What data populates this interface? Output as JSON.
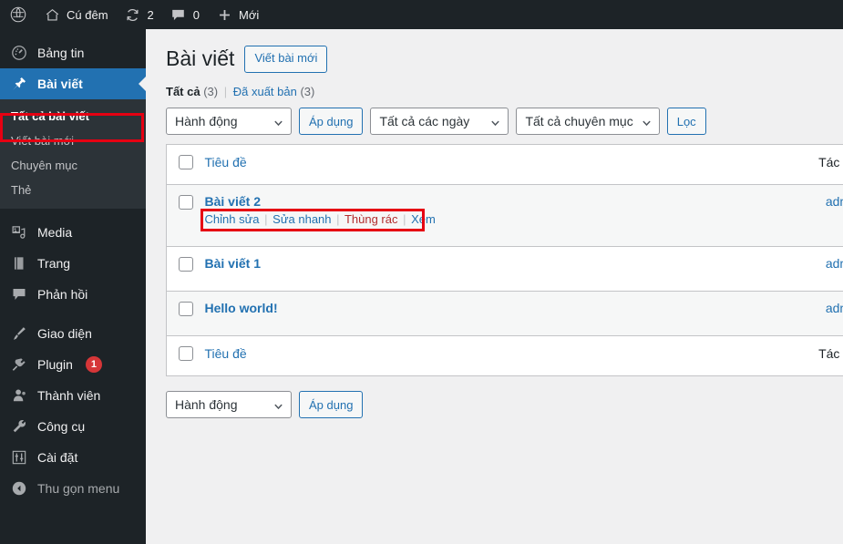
{
  "admin_bar": {
    "items": [
      {
        "icon": "wordpress-logo-icon",
        "label": "",
        "count": ""
      },
      {
        "icon": "home-icon",
        "label": "Cú đêm",
        "count": ""
      },
      {
        "icon": "update-icon",
        "label": "",
        "count": "2"
      },
      {
        "icon": "comment-icon",
        "label": "",
        "count": "0"
      },
      {
        "icon": "plus-icon",
        "label": "Mới",
        "count": ""
      }
    ],
    "site_name": "Cú đêm",
    "updates_count": "2",
    "comments_count": "0",
    "new_label": "Mới"
  },
  "sidebar": {
    "items": [
      {
        "label": "Bảng tin",
        "icon": "dashboard-icon",
        "name": "dashboard"
      },
      {
        "label": "Bài viết",
        "icon": "pin-icon",
        "name": "posts"
      },
      {
        "label": "Media",
        "icon": "media-icon",
        "name": "media"
      },
      {
        "label": "Trang",
        "icon": "page-icon",
        "name": "pages"
      },
      {
        "label": "Phản hồi",
        "icon": "comment-icon",
        "name": "comments"
      },
      {
        "label": "Giao diện",
        "icon": "appearance-brush-icon",
        "name": "appearance"
      },
      {
        "label": "Plugin",
        "icon": "plugin-plug-icon",
        "name": "plugins",
        "badge": "1"
      },
      {
        "label": "Thành viên",
        "icon": "users-icon",
        "name": "users"
      },
      {
        "label": "Công cụ",
        "icon": "tools-wrench-icon",
        "name": "tools"
      },
      {
        "label": "Cài đặt",
        "icon": "settings-sliders-icon",
        "name": "settings"
      },
      {
        "label": "Thu gọn menu",
        "icon": "collapse-arrow-icon",
        "name": "collapse"
      }
    ],
    "submenu": [
      {
        "label": "Tất cả bài viết",
        "current": true
      },
      {
        "label": "Viết bài mới",
        "current": false
      },
      {
        "label": "Chuyên mục",
        "current": false
      },
      {
        "label": "Thẻ",
        "current": false
      }
    ],
    "plugin_badge": "1"
  },
  "main": {
    "page_title": "Bài viết",
    "add_new_label": "Viết bài mới",
    "filters": {
      "all_label": "Tất cả",
      "all_count": "(3)",
      "separator": "|",
      "published_label": "Đã xuất bản",
      "published_count": "(3)"
    },
    "toolbar_top": {
      "bulk_action_value": "Hành động",
      "apply_label": "Áp dụng",
      "date_filter_value": "Tất cả các ngày",
      "category_filter_value": "Tất cả chuyên mục",
      "filter_label": "Lọc"
    },
    "toolbar_bottom": {
      "bulk_action_value": "Hành động",
      "apply_label": "Áp dụng"
    },
    "table": {
      "columns": {
        "title": "Tiêu đề",
        "author": "Tác giả"
      },
      "rows": [
        {
          "title": "Bài viết 2",
          "author": "admin",
          "actions": {
            "edit": "Chỉnh sửa",
            "quick_edit": "Sửa nhanh",
            "trash": "Thùng rác",
            "view": "Xem",
            "separator": "|"
          }
        },
        {
          "title": "Bài viết 1",
          "author": "admin"
        },
        {
          "title": "Hello world!",
          "author": "admin"
        }
      ]
    }
  },
  "annotations": {
    "color": "#e60012",
    "boxes": [
      {
        "target": "sidebar-item-all-posts"
      },
      {
        "target": "row-actions-bai-viet-2"
      }
    ]
  }
}
